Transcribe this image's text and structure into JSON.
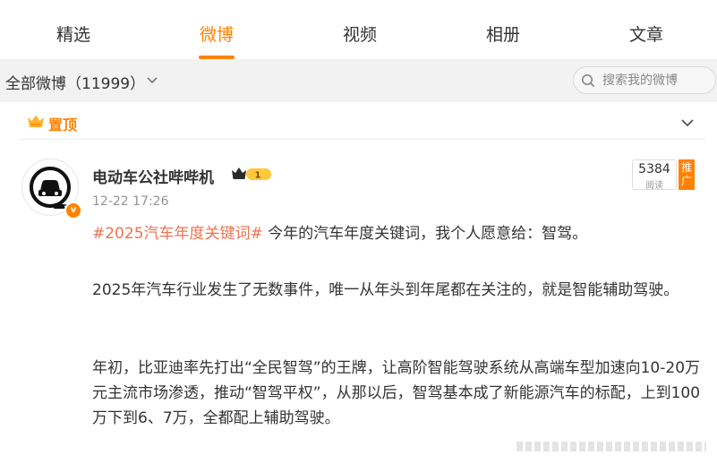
{
  "tabs": [
    {
      "label": "精选",
      "active": false
    },
    {
      "label": "微博",
      "active": true
    },
    {
      "label": "视频",
      "active": false
    },
    {
      "label": "相册",
      "active": false
    },
    {
      "label": "文章",
      "active": false
    }
  ],
  "filter": {
    "label": "全部微博（11999）",
    "search_placeholder": "搜索我的微博"
  },
  "pinned": {
    "label": "置顶"
  },
  "post": {
    "author": "电动车公社哔哔机",
    "member_level": "1",
    "time": "12-22 17:26",
    "views": "5384",
    "views_caption": "阅读",
    "promote_label": "推广",
    "hashtag": "#2025汽车年度关键词#",
    "paragraphs": [
      "今年的汽车年度关键词，我个人愿意给：智驾。",
      "2025年汽车行业发生了无数事件，唯一从年头到年尾都在关注的，就是智能辅助驾驶。",
      "年初，比亚迪率先打出“全民智驾”的王牌，让高阶智能驾驶系统从高端车型加速向10-20万元主流市场渗透，推动“智驾平权”，从那以后，智驾基本成了新能源汽车的标配，上到100万下到6、7万，全都配上辅助驾驶。"
    ]
  },
  "colors": {
    "accent": "#ff8200",
    "hashtag": "#eb7350",
    "filter_bg": "#f2f2f2"
  },
  "icons": [
    "chevron-down-icon",
    "search-icon",
    "crown-icon",
    "verified-badge-icon",
    "member-crown-icon"
  ]
}
